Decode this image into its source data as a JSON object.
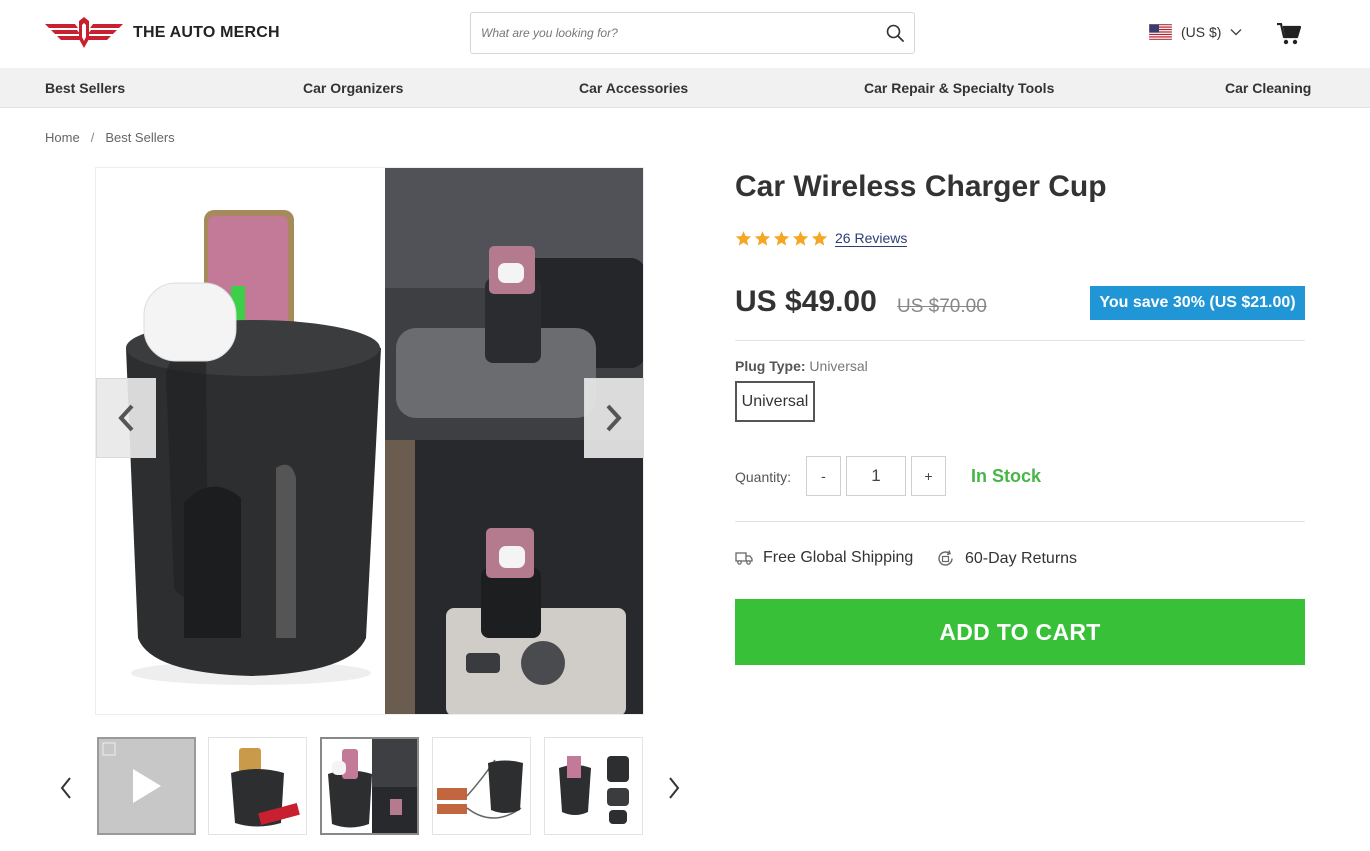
{
  "brand": {
    "name": "THE AUTO MERCH"
  },
  "search": {
    "placeholder": "What are you looking for?"
  },
  "currency": {
    "label": "(US $)"
  },
  "nav": {
    "items": [
      "Best Sellers",
      "Car Organizers",
      "Car Accessories",
      "Car Repair & Specialty Tools",
      "Car Cleaning"
    ]
  },
  "breadcrumb": {
    "home": "Home",
    "separator": "/",
    "current": "Best Sellers"
  },
  "product": {
    "title": "Car Wireless Charger Cup",
    "rating": 5,
    "reviews_label": "26 Reviews",
    "price": "US $49.00",
    "compare_price": "US $70.00",
    "save_label": "You save 30% (US $21.00)",
    "option_name": "Plug Type:",
    "option_value": "Universal",
    "variant_label": "Universal",
    "quantity_label": "Quantity:",
    "quantity_minus": "-",
    "quantity_value": "1",
    "quantity_plus": "+",
    "stock_label": "In Stock",
    "shipping_label": "Free Global Shipping",
    "returns_label": "60-Day Returns",
    "cta_label": "ADD TO CART"
  },
  "colors": {
    "brand_red": "#c8202f",
    "save_badge": "#2196d6",
    "stock_green": "#47b547",
    "cta_green": "#38c138",
    "star": "#f5a623",
    "review_link": "#2c3e74"
  },
  "icons": {
    "search": "search-icon",
    "cart": "cart-icon",
    "flag": "us-flag-icon",
    "dropdown": "chevron-down-icon",
    "shipping": "truck-icon",
    "returns": "returns-icon",
    "prev": "chevron-left-icon",
    "next": "chevron-right-icon",
    "play": "play-icon"
  },
  "gallery": {
    "thumbnails": [
      "video",
      "product-offer",
      "product-in-car",
      "product-cables",
      "product-parts"
    ],
    "active_index": 2
  }
}
